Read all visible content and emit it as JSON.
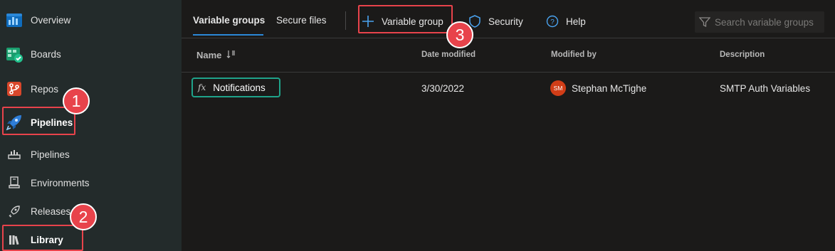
{
  "sidebar": {
    "items": [
      {
        "label": "Overview"
      },
      {
        "label": "Boards"
      },
      {
        "label": "Repos"
      },
      {
        "label": "Pipelines"
      },
      {
        "label": "Pipelines"
      },
      {
        "label": "Environments"
      },
      {
        "label": "Releases"
      },
      {
        "label": "Library"
      }
    ]
  },
  "toolbar": {
    "tabs": [
      {
        "label": "Variable groups"
      },
      {
        "label": "Secure files"
      }
    ],
    "add_label": "Variable group",
    "security_label": "Security",
    "help_label": "Help",
    "search_placeholder": "Search variable groups"
  },
  "table": {
    "headers": {
      "name": "Name",
      "date": "Date modified",
      "modified_by": "Modified by",
      "description": "Description"
    },
    "rows": [
      {
        "name": "Notifications",
        "fx": "fx",
        "date": "3/30/2022",
        "initials": "SM",
        "modified_by": "Stephan McTighe",
        "description": "SMTP Auth Variables"
      }
    ]
  },
  "annotations": {
    "badge_1": "1",
    "badge_2": "2",
    "badge_3": "3"
  },
  "colors": {
    "accent": "#2b88d8",
    "highlight": "#e8434b",
    "selection": "#1fa38a",
    "avatar": "#d13d17"
  }
}
